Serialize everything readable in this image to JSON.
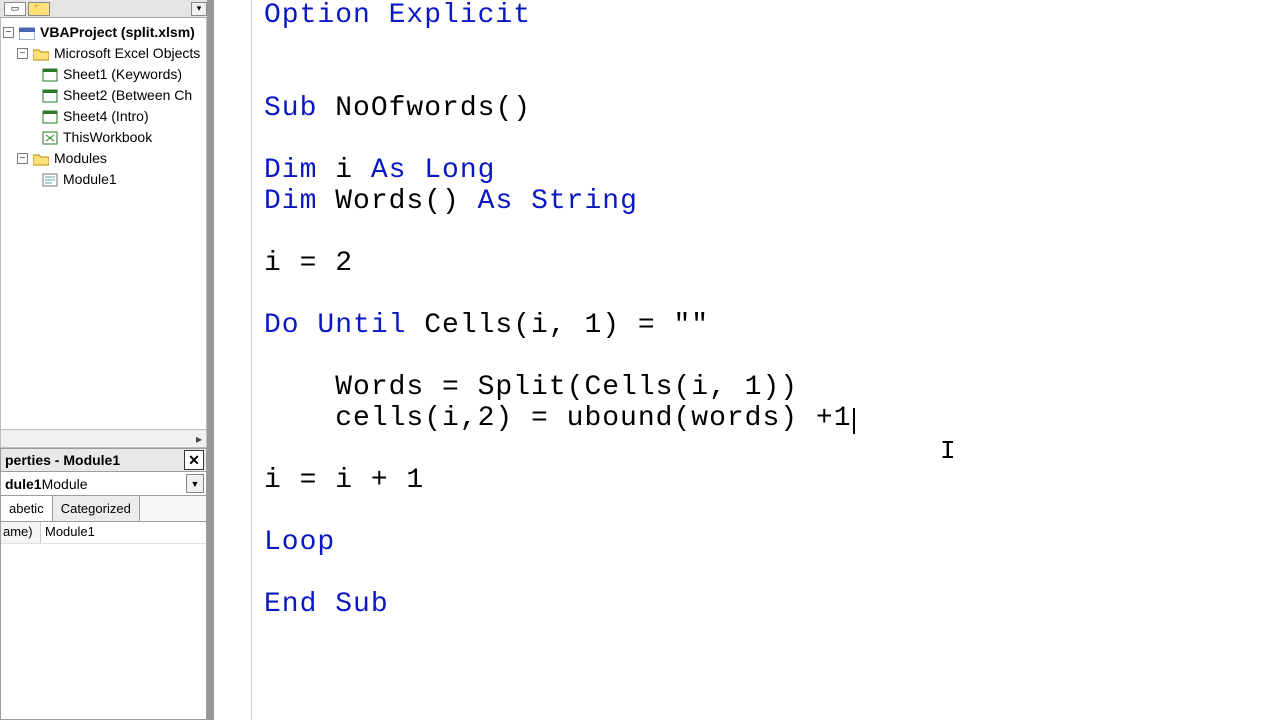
{
  "project": {
    "root": "VBAProject (split.xlsm)",
    "excel_objects_label": "Microsoft Excel Objects",
    "sheets": [
      "Sheet1 (Keywords)",
      "Sheet2 (Between Ch",
      "Sheet4 (Intro)",
      "ThisWorkbook"
    ],
    "modules_label": "Modules",
    "modules": [
      "Module1"
    ]
  },
  "properties": {
    "title": "perties - Module1",
    "dropdown_bold": "dule1",
    "dropdown_rest": " Module",
    "tab_alpha": "abetic",
    "tab_cat": "Categorized",
    "row_key": "ame)",
    "row_val": "Module1"
  },
  "code": {
    "option_explicit": "Option Explicit",
    "sub_kw": "Sub",
    "sub_name": " NoOfwords()",
    "dim1_a": "Dim",
    "dim1_b": " i ",
    "dim1_c": "As Long",
    "dim2_a": "Dim",
    "dim2_b": " Words() ",
    "dim2_c": "As String",
    "assign_i": "i = 2",
    "do_until": "Do Until",
    "do_rest": " Cells(i, 1) = \"\"",
    "body1": "    Words = Split(Cells(i, 1))",
    "body2": "    cells(i,2) = ubound(words) +1",
    "incr": "i = i + 1",
    "loop": "Loop",
    "end_sub": "End Sub"
  }
}
